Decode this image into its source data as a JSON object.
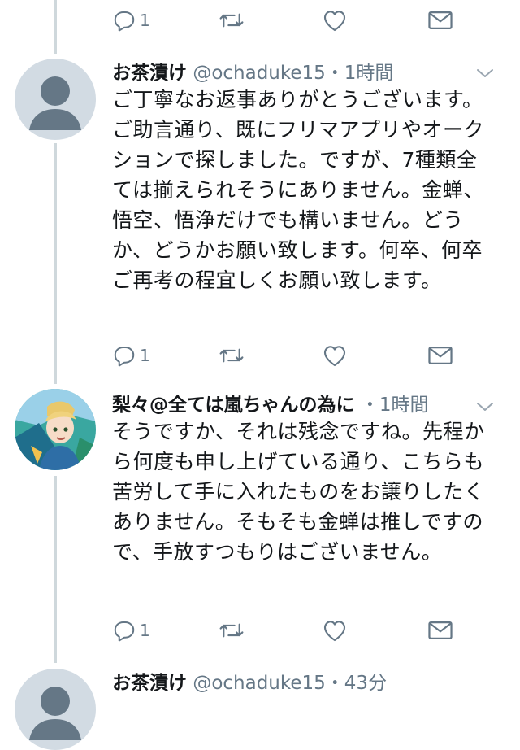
{
  "colors": {
    "text": "#14171a",
    "secondary": "#657786",
    "thread_line": "#cfd8dc",
    "avatar_default": "#d2dbe3"
  },
  "icons": {
    "reply": "reply-icon",
    "retweet": "retweet-icon",
    "like": "heart-icon",
    "dm": "mail-icon",
    "menu": "chevron-down-icon"
  },
  "top_actions": {
    "reply_count": "1"
  },
  "tweets": [
    {
      "name": "お茶漬け",
      "handle": "@ochaduke15",
      "separator": "・",
      "time": "1時間",
      "text": "ご丁寧なお返事ありがとうございます。ご助言通り、既にフリマアプリやオークションで探しました。ですが、7種類全ては揃えられそうにありません。金蝉、悟空、悟浄だけでも構いません。どうか、どうかお願い致します。何卒、何卒ご再考の程宜しくお願い致します。",
      "reply_count": "1"
    },
    {
      "name": "梨々@全ては嵐ちゃんの為に",
      "handle": "",
      "separator": "・",
      "time": "1時間",
      "text": "そうですか、それは残念ですね。先程から何度も申し上げている通り、こちらも苦労して手に入れたものをお譲りしたくありません。そもそも金蝉は推しですので、手放すつもりはございません。",
      "reply_count": "1"
    },
    {
      "name": "お茶漬け",
      "handle": "@ochaduke15",
      "separator": "・",
      "time": "43分"
    }
  ]
}
